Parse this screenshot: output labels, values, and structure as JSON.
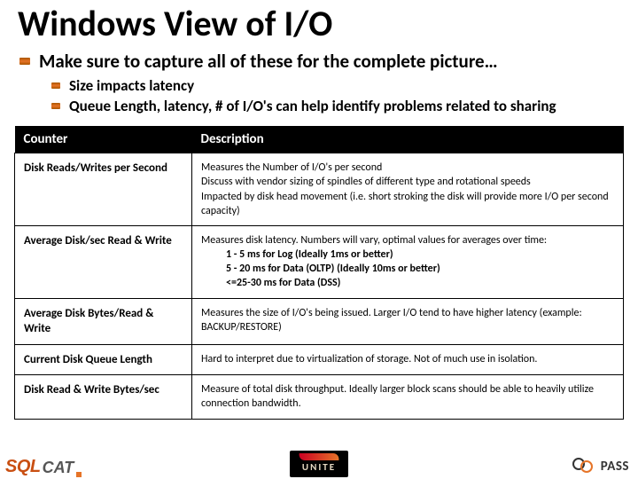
{
  "title": "Windows View of I/O",
  "bullets": {
    "main": "Make sure to capture all of these for the complete picture…",
    "subs": [
      "Size impacts latency",
      "Queue Length, latency, # of I/O's can help identify problems related to sharing"
    ]
  },
  "table": {
    "headers": {
      "c1": "Counter",
      "c2": "Description"
    },
    "rows": [
      {
        "counter": "Disk Reads/Writes per Second",
        "desc_lines": [
          "Measures the Number of I/O's per second",
          "Discuss with vendor sizing of spindles of different type and rotational speeds",
          "Impacted by disk head movement (i.e. short stroking the disk will provide more I/O per second capacity)"
        ]
      },
      {
        "counter": "Average Disk/sec Read & Write",
        "desc_intro": "Measures disk latency. Numbers will vary, optimal values for averages over time:",
        "desc_subs": [
          "1 - 5 ms for Log (Ideally 1ms or better)",
          "5 - 20 ms for Data (OLTP) (Ideally 10ms or better)",
          "<=25-30 ms for Data (DSS)"
        ]
      },
      {
        "counter": "Average Disk Bytes/Read & Write",
        "desc": "Measures the size of I/O's being issued.  Larger I/O tend to have higher latency (example: BACKUP/RESTORE)"
      },
      {
        "counter": "Current Disk Queue Length",
        "desc": "Hard to interpret due to virtualization of storage. Not of much use in isolation."
      },
      {
        "counter": "Disk Read & Write Bytes/sec",
        "desc": "Measure of total disk throughput.  Ideally larger block scans should be able to heavily utilize connection bandwidth."
      }
    ]
  },
  "footer": {
    "sqlcat": {
      "sql": "SQL",
      "cat": "CAT"
    },
    "unite": "UNITE",
    "pass": "PASS"
  }
}
